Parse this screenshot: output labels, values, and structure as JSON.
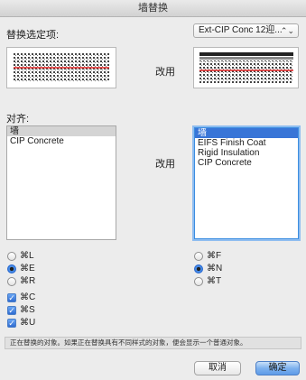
{
  "window": {
    "title": "墙替换"
  },
  "replace": {
    "label": "替换选定项:",
    "popup_value": "Ext-CIP Conc 12迎...",
    "popup_arrows": "⌃⌄"
  },
  "preview": {
    "mid_label": "改用"
  },
  "align": {
    "label": "对齐:"
  },
  "lists": {
    "mid_label": "改用",
    "left": [
      "墙",
      "CIP Concrete"
    ],
    "right": [
      "墙",
      "EIFS Finish Coat",
      "Rigid Insulation",
      "CIP Concrete"
    ]
  },
  "options": {
    "left_radios": [
      "⌘L",
      "⌘E",
      "⌘R"
    ],
    "right_radios": [
      "⌘F",
      "⌘N",
      "⌘T"
    ],
    "checks": [
      "⌘C",
      "⌘S",
      "⌘U"
    ],
    "check_mark": "✓"
  },
  "status": {
    "text": "正在替换的对象。如果正在替换具有不同样式的对象，便会显示一个普通对象。"
  },
  "buttons": {
    "cancel": "取消",
    "ok": "确定"
  },
  "colors": {
    "accent": "#3875d7",
    "preview_line": "#e02020"
  }
}
